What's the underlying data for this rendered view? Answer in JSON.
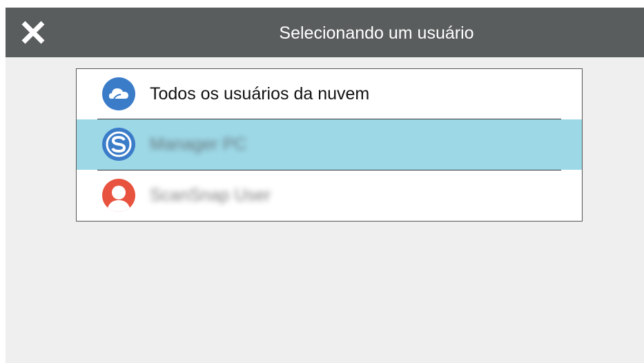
{
  "header": {
    "title": "Selecionando um usuário",
    "close_icon": "close-icon"
  },
  "users": [
    {
      "label": "Todos os usuários da nuvem",
      "icon": "cloud-icon",
      "color": "#3b7cc9",
      "selected": false
    },
    {
      "label": "Manager PC",
      "icon": "scansnap-s-icon",
      "color": "#3b7cc9",
      "selected": true
    },
    {
      "label": "ScanSnap User",
      "icon": "user-avatar-icon",
      "color": "#e8533f",
      "selected": false
    }
  ],
  "colors": {
    "titlebar": "#5a5d5d",
    "background": "#efefef",
    "selection": "#9dd8e7"
  }
}
